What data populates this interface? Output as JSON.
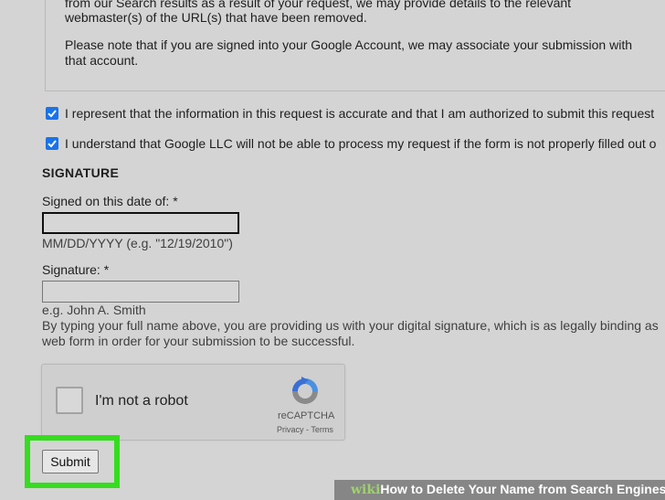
{
  "notice": {
    "line1": "from our Search results as a result of your request, we may provide details to the relevant",
    "line2": "webmaster(s) of the URL(s) that have been removed.",
    "line3": "Please note that if you are signed into your Google Account, we may associate your submission with",
    "line4": "that account."
  },
  "checkboxes": [
    {
      "checked": true,
      "label": "I represent that the information in this request is accurate and that I am authorized to submit this request"
    },
    {
      "checked": true,
      "label": "I understand that Google LLC will not be able to process my request if the form is not properly filled out o"
    }
  ],
  "signature": {
    "section_title": "SIGNATURE",
    "date_label": "Signed on this date of: *",
    "date_value": "",
    "date_hint": "MM/DD/YYYY (e.g. \"12/19/2010\")",
    "signature_label": "Signature: *",
    "signature_value": "",
    "signature_hint": "e.g. John A. Smith",
    "disclaimer_line1": "By typing your full name above, you are providing us with your digital signature, which is as legally binding as",
    "disclaimer_line2": "web form in order for your submission to be successful."
  },
  "captcha": {
    "label": "I'm not a robot",
    "brand": "reCAPTCHA",
    "links": "Privacy - Terms",
    "checked": false
  },
  "submit": {
    "label": "Submit",
    "highlight_color": "#35dd1e"
  },
  "watermark": {
    "logo": "wiki",
    "text": "How to Delete Your Name from Search Engines"
  },
  "colors": {
    "checkbox": "#1a73e8",
    "background": "#d4d4d4"
  }
}
